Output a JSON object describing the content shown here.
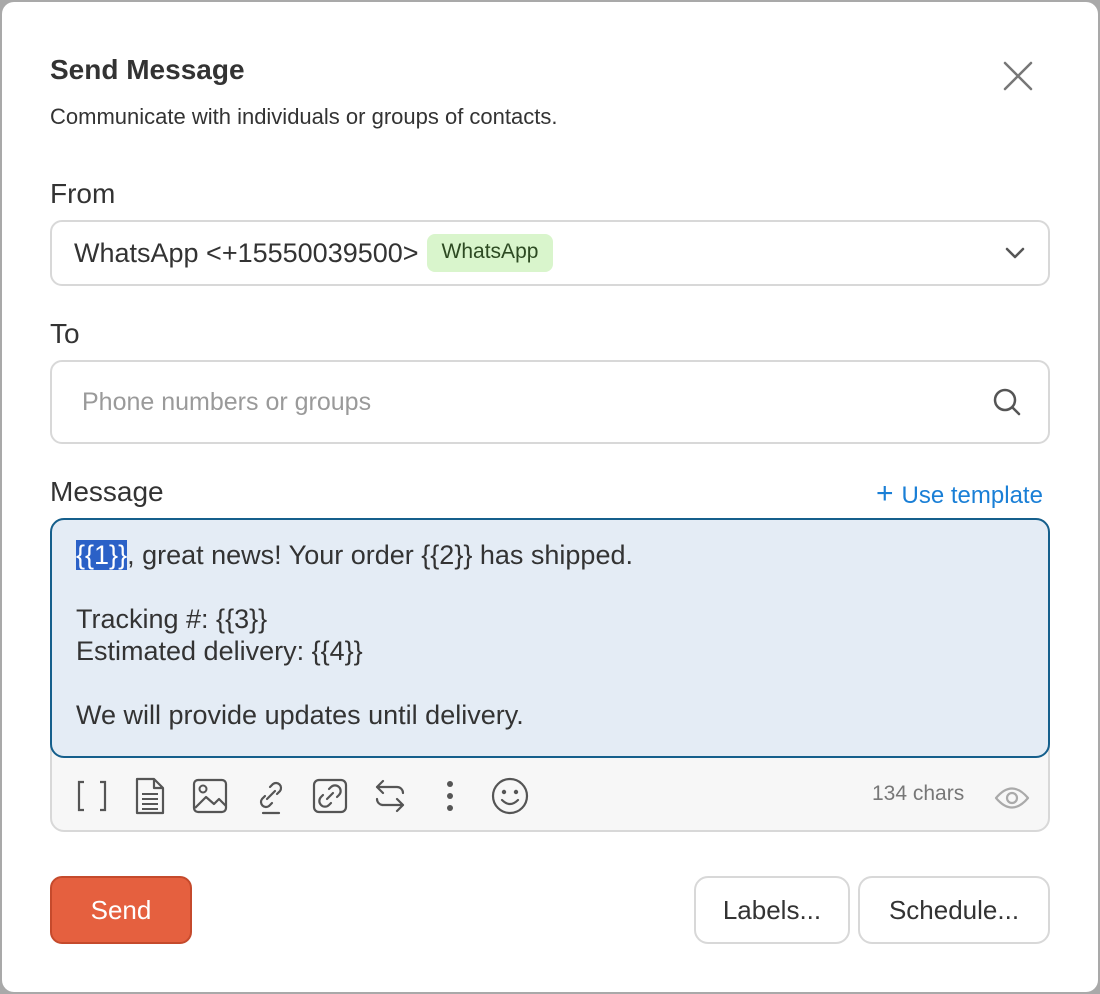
{
  "dialog": {
    "title": "Send Message",
    "subtitle": "Communicate with individuals or groups of contacts."
  },
  "from": {
    "label": "From",
    "value": "WhatsApp <+15550039500>",
    "badge": "WhatsApp"
  },
  "to": {
    "label": "To",
    "placeholder": "Phone numbers or groups",
    "value": ""
  },
  "message": {
    "label": "Message",
    "use_template": "Use template",
    "highlighted_token": "{{1}}",
    "line1_rest": ", great news! Your order {{2}} has shipped.",
    "line3": "Tracking #: {{3}}",
    "line4": "Estimated delivery: {{4}}",
    "line6": "We will provide updates until delivery.",
    "char_count": "134 chars"
  },
  "toolbar": {
    "icons": [
      "brackets-icon",
      "document-icon",
      "image-icon",
      "link-icon",
      "link-box-icon",
      "swap-icon",
      "more-vertical-icon",
      "emoji-icon",
      "eye-icon"
    ]
  },
  "actions": {
    "send": "Send",
    "labels": "Labels...",
    "schedule": "Schedule..."
  },
  "colors": {
    "accent": "#e5603f",
    "link": "#1a7fd6",
    "badge_bg": "#d9f5cc",
    "message_bg": "#e4ecf5",
    "message_border": "#155f8c",
    "highlight": "#2b61c7"
  }
}
